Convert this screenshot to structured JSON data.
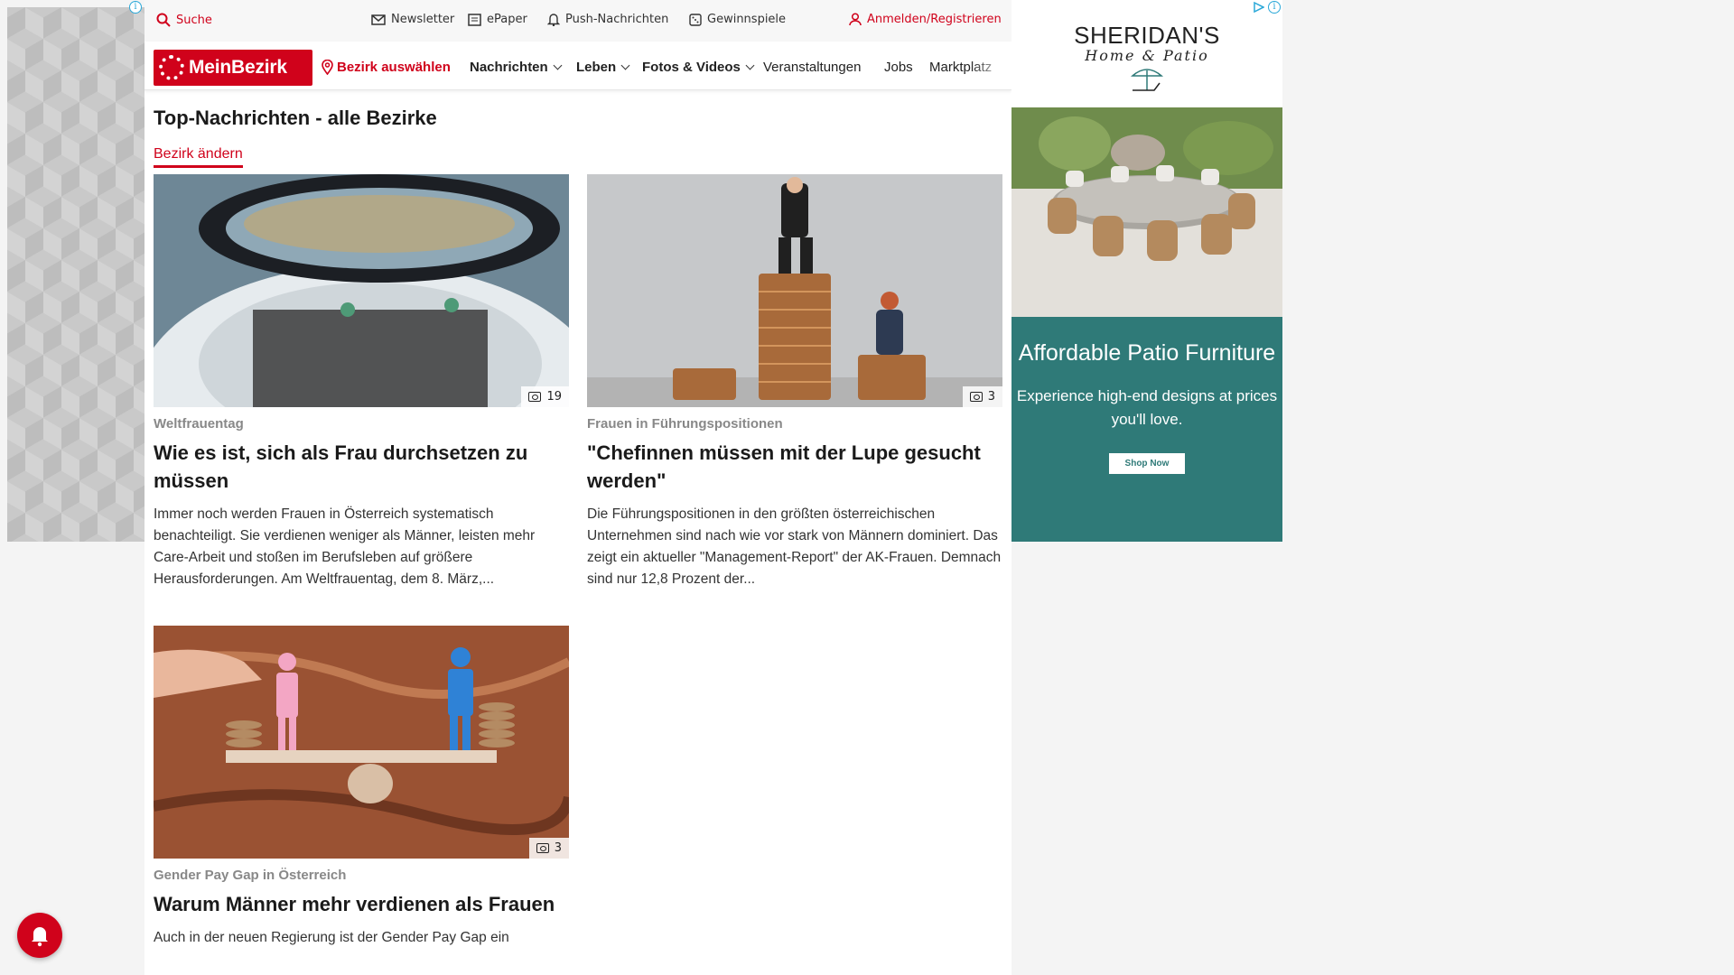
{
  "topbar": {
    "search": "Suche",
    "newsletter": "Newsletter",
    "epaper": "ePaper",
    "push": "Push-Nachrichten",
    "gewinnspiele": "Gewinnspiele",
    "login": "Anmelden/Registrieren"
  },
  "nav": {
    "logo": "MeinBezirk",
    "select_district": "Bezirk auswählen",
    "items": [
      "Nachrichten",
      "Leben",
      "Fotos & Videos",
      "Veranstaltungen",
      "Jobs",
      "Marktplatz"
    ]
  },
  "page": {
    "title": "Top-Nachrichten - alle Bezirke",
    "change_link": "Bezirk ändern"
  },
  "articles": [
    {
      "category": "Weltfrauentag",
      "title": "Wie es ist, sich als Frau durchsetzen zu müssen",
      "text": "Immer noch werden Frauen in Österreich systematisch benachteiligt. Sie verdienen weniger als Männer, leisten mehr Care-Arbeit und stoßen im Berufsleben auf größere Herausforderungen. Am Weltfrauentag, dem 8. März,...",
      "image_count": "19"
    },
    {
      "category": "Frauen in Führungspositionen",
      "title": "\"Chefinnen müssen mit der Lupe gesucht werden\"",
      "text": "Die Führungspositionen in den größten österreichischen Unternehmen sind nach wie vor stark von Männern dominiert. Das zeigt ein aktueller \"Management-Report\" der AK-Frauen. Demnach sind nur 12,8 Prozent der...",
      "image_count": "3"
    },
    {
      "category": "Gender Pay Gap in Österreich",
      "title": "Warum Männer mehr verdienen als Frauen",
      "text": "Auch in der neuen Regierung ist der Gender Pay Gap ein",
      "image_count": "3"
    }
  ],
  "ad": {
    "brand": "SHERIDAN'S",
    "brand_sub": "Home & Patio",
    "headline": "Affordable Patio Furniture",
    "copy": "Experience high-end designs at prices you'll love.",
    "button": "Shop Now",
    "panel_color": "#2f7a78"
  },
  "colors": {
    "accent": "#d0021b"
  }
}
